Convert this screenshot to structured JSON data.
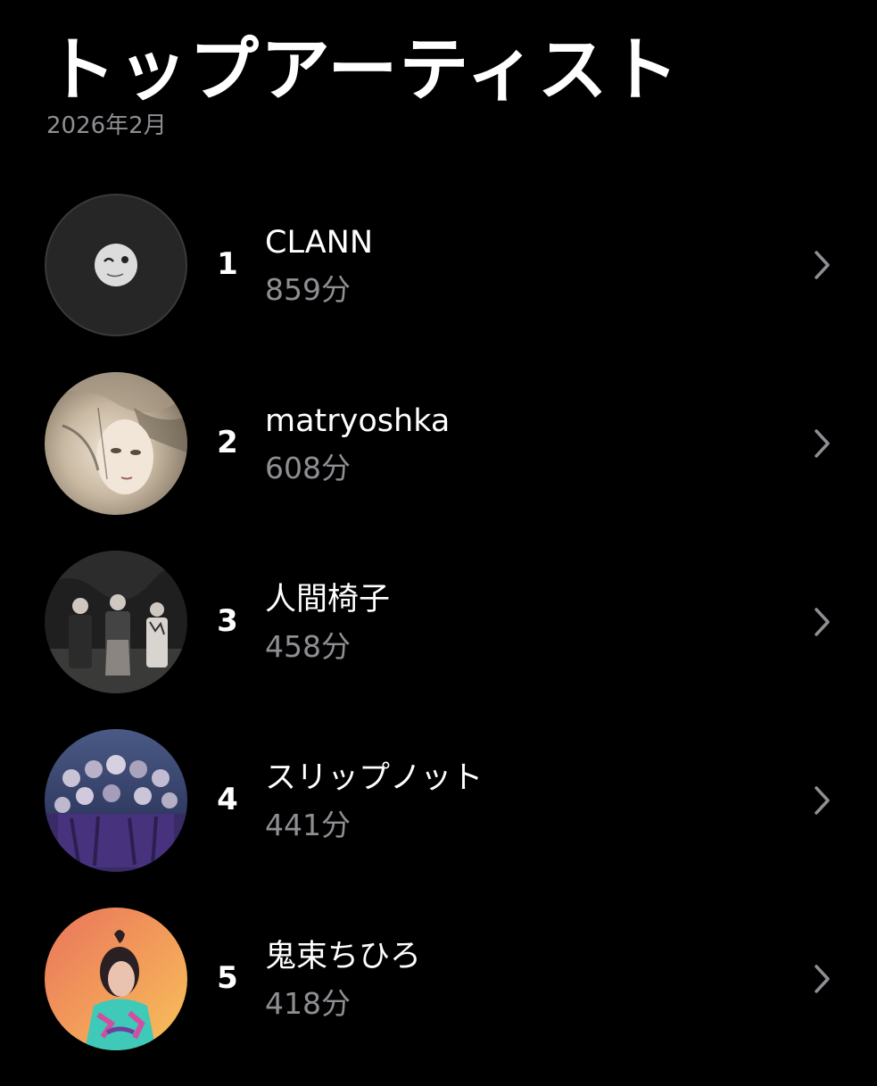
{
  "header": {
    "title": "トップアーティスト",
    "subtitle": "2026年2月"
  },
  "artists": [
    {
      "rank": "1",
      "name": "CLANN",
      "minutes": "859分",
      "avatar_icon": "clann-avatar"
    },
    {
      "rank": "2",
      "name": "matryoshka",
      "minutes": "608分",
      "avatar_icon": "matryoshka-avatar"
    },
    {
      "rank": "3",
      "name": "人間椅子",
      "minutes": "458分",
      "avatar_icon": "ningen-isu-avatar"
    },
    {
      "rank": "4",
      "name": "スリップノット",
      "minutes": "441分",
      "avatar_icon": "slipknot-avatar"
    },
    {
      "rank": "5",
      "name": "鬼束ちひろ",
      "minutes": "418分",
      "avatar_icon": "onitsuka-chihiro-avatar"
    }
  ],
  "icons": {
    "row_chevron": "chevron-right-icon"
  },
  "colors": {
    "background": "#000000",
    "primary_text": "#ffffff",
    "secondary_text": "#8e8e93",
    "chevron": "#8e8e93"
  }
}
